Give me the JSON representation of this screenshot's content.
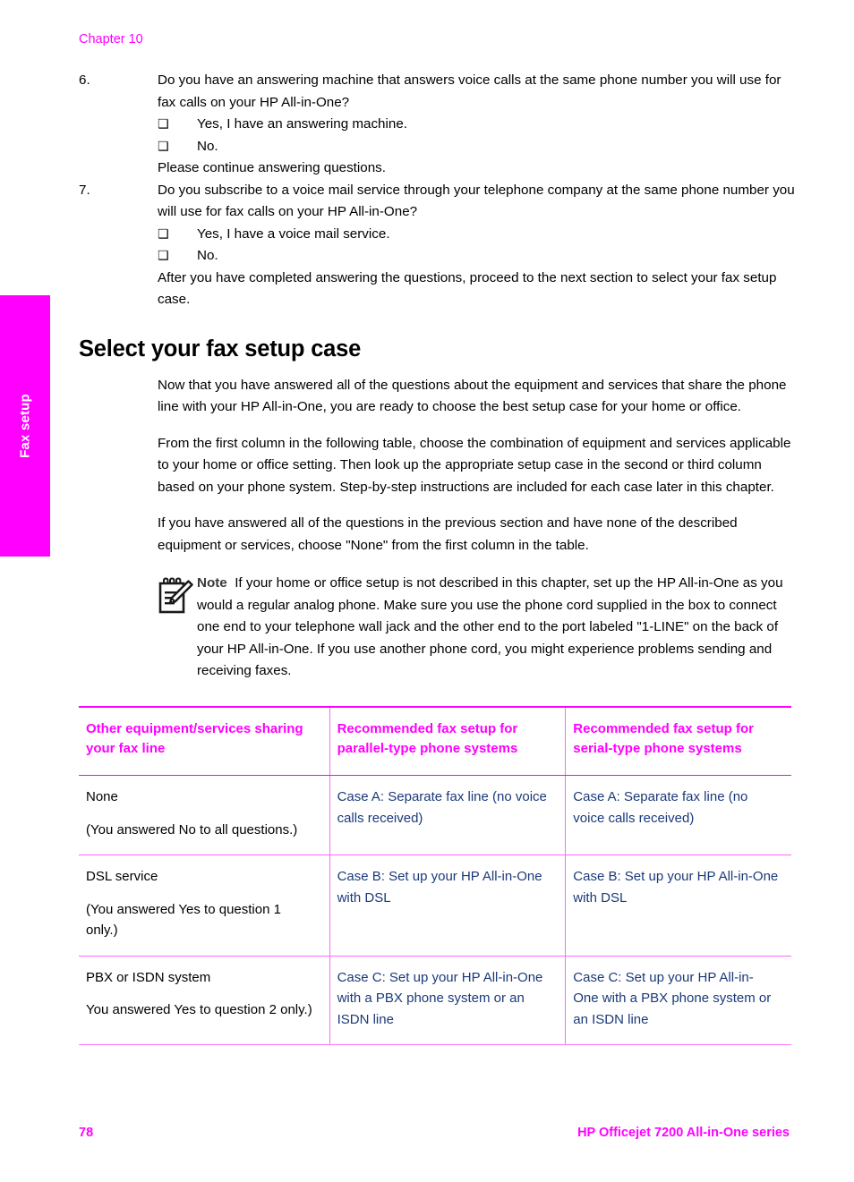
{
  "page": {
    "chapter_label": "Chapter 10",
    "side_tab_label": "Fax setup",
    "footer_page_number": "78",
    "footer_product": "HP Officejet 7200 All-in-One series",
    "accent_color": "#ff00ff",
    "link_color": "#1a3a7a"
  },
  "questions": [
    {
      "number": "6.",
      "text": "Do you have an answering machine that answers voice calls at the same phone number you will use for fax calls on your HP All-in-One?",
      "options": [
        {
          "checkbox": "❑",
          "label": "Yes, I have an answering machine."
        },
        {
          "checkbox": "❑",
          "label": "No."
        }
      ],
      "follow_up": "Please continue answering questions."
    },
    {
      "number": "7.",
      "text": "Do you subscribe to a voice mail service through your telephone company at the same phone number you will use for fax calls on your HP All-in-One?",
      "options": [
        {
          "checkbox": "❑",
          "label": "Yes, I have a voice mail service."
        },
        {
          "checkbox": "❑",
          "label": "No."
        }
      ],
      "follow_up": "After you have completed answering the questions, proceed to the next section to select your fax setup case."
    }
  ],
  "section": {
    "heading": "Select your fax setup case",
    "paragraphs": [
      "Now that you have answered all of the questions about the equipment and services that share the phone line with your HP All-in-One, you are ready to choose the best setup case for your home or office.",
      "From the first column in the following table, choose the combination of equipment and services applicable to your home or office setting. Then look up the appropriate setup case in the second or third column based on your phone system. Step-by-step instructions are included for each case later in this chapter.",
      "If you have answered all of the questions in the previous section and have none of the described equipment or services, choose \"None\" from the first column in the table."
    ]
  },
  "note": {
    "icon": "note-pencil-icon",
    "label": "Note",
    "text": "If your home or office setup is not described in this chapter, set up the HP All-in-One as you would a regular analog phone. Make sure you use the phone cord supplied in the box to connect one end to your telephone wall jack and the other end to the port labeled \"1-LINE\" on the back of your HP All-in-One. If you use another phone cord, you might experience problems sending and receiving faxes."
  },
  "table": {
    "headers": [
      "Other equipment/services sharing your fax line",
      "Recommended fax setup for parallel-type phone systems",
      "Recommended fax setup for serial-type phone systems"
    ],
    "rows": [
      {
        "equipment_main": "None",
        "equipment_note": "(You answered No to all questions.)",
        "parallel": "Case A: Separate fax line (no voice calls received)",
        "serial": "Case A: Separate fax line (no voice calls received)"
      },
      {
        "equipment_main": "DSL service",
        "equipment_note": "(You answered Yes to question 1 only.)",
        "parallel": "Case B: Set up your HP All-in-One with DSL",
        "serial": "Case B: Set up your HP All-in-One with DSL"
      },
      {
        "equipment_main": "PBX or ISDN system",
        "equipment_note": "You answered Yes to question 2 only.)",
        "parallel": "Case C: Set up your HP All-in-One with a PBX phone system or an ISDN line",
        "serial": "Case C: Set up your HP All-in-One with a PBX phone system or an ISDN line"
      }
    ]
  }
}
